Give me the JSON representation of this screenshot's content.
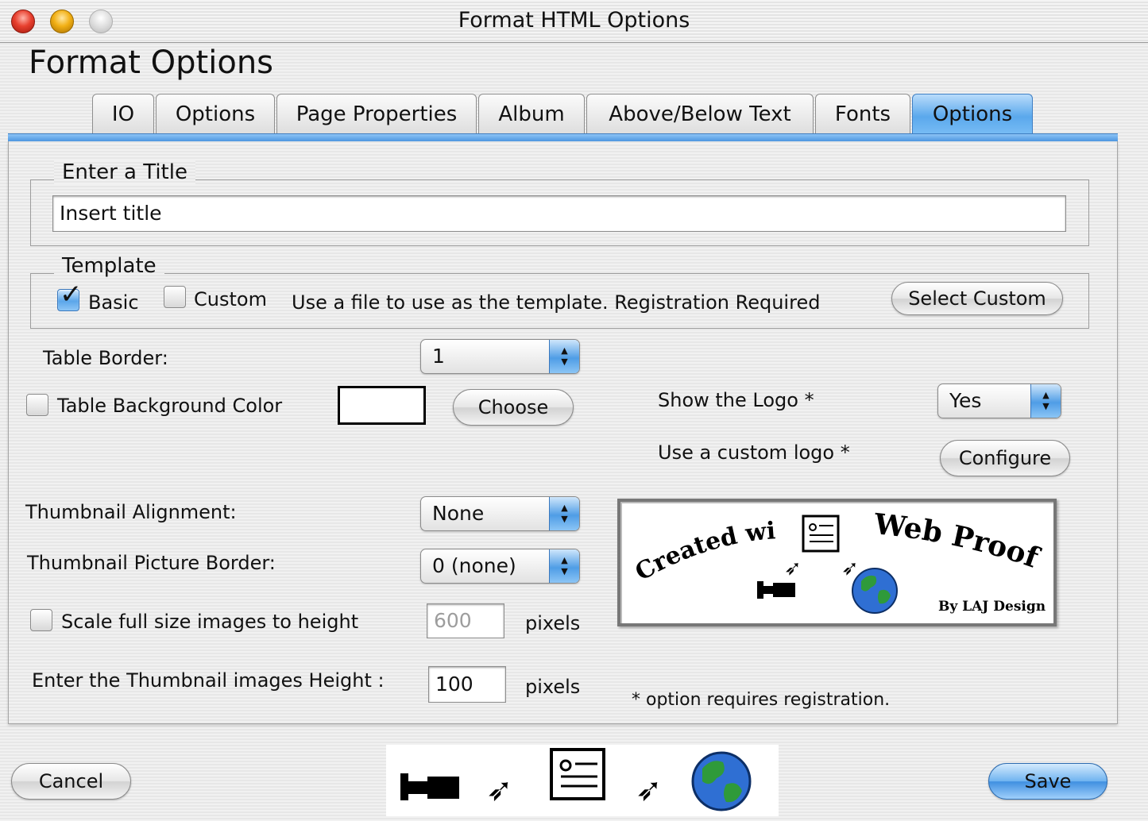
{
  "window": {
    "title": "Format HTML Options"
  },
  "heading": "Format Options",
  "tabs": [
    {
      "label": "IO"
    },
    {
      "label": "Options"
    },
    {
      "label": "Page Properties"
    },
    {
      "label": "Album"
    },
    {
      "label": "Above/Below Text"
    },
    {
      "label": "Fonts"
    },
    {
      "label": "Options"
    }
  ],
  "active_tab_index": 6,
  "title_group": {
    "legend": "Enter a Title",
    "input_value": "Insert title"
  },
  "template_group": {
    "legend": "Template",
    "basic_label": "Basic",
    "basic_checked": true,
    "custom_label": "Custom",
    "custom_checked": false,
    "description": "Use a file to use as the template. Registration Required",
    "select_custom_button": "Select Custom"
  },
  "table_border": {
    "label": "Table Border:",
    "value": "1"
  },
  "table_bg": {
    "label": "Table Background Color",
    "checked": false,
    "color": "#ffffff",
    "choose_button": "Choose"
  },
  "show_logo": {
    "label": "Show the Logo *",
    "value": "Yes"
  },
  "custom_logo": {
    "label": "Use a custom logo *",
    "configure_button": "Configure"
  },
  "thumb_alignment": {
    "label": "Thumbnail Alignment:",
    "value": "None"
  },
  "thumb_border": {
    "label": "Thumbnail Picture  Border:",
    "value": "0 (none)"
  },
  "scale": {
    "label": "Scale full size images to height",
    "checked": false,
    "value": "600",
    "unit": "pixels"
  },
  "thumb_height": {
    "label": "Enter the Thumbnail images Height :",
    "value": "100",
    "unit": "pixels"
  },
  "registration_note": "* option requires registration.",
  "logo": {
    "line1": "Created with",
    "line2": "Web Proofs",
    "byline": "By LAJ Design"
  },
  "footer": {
    "cancel_button": "Cancel",
    "save_button": "Save"
  }
}
